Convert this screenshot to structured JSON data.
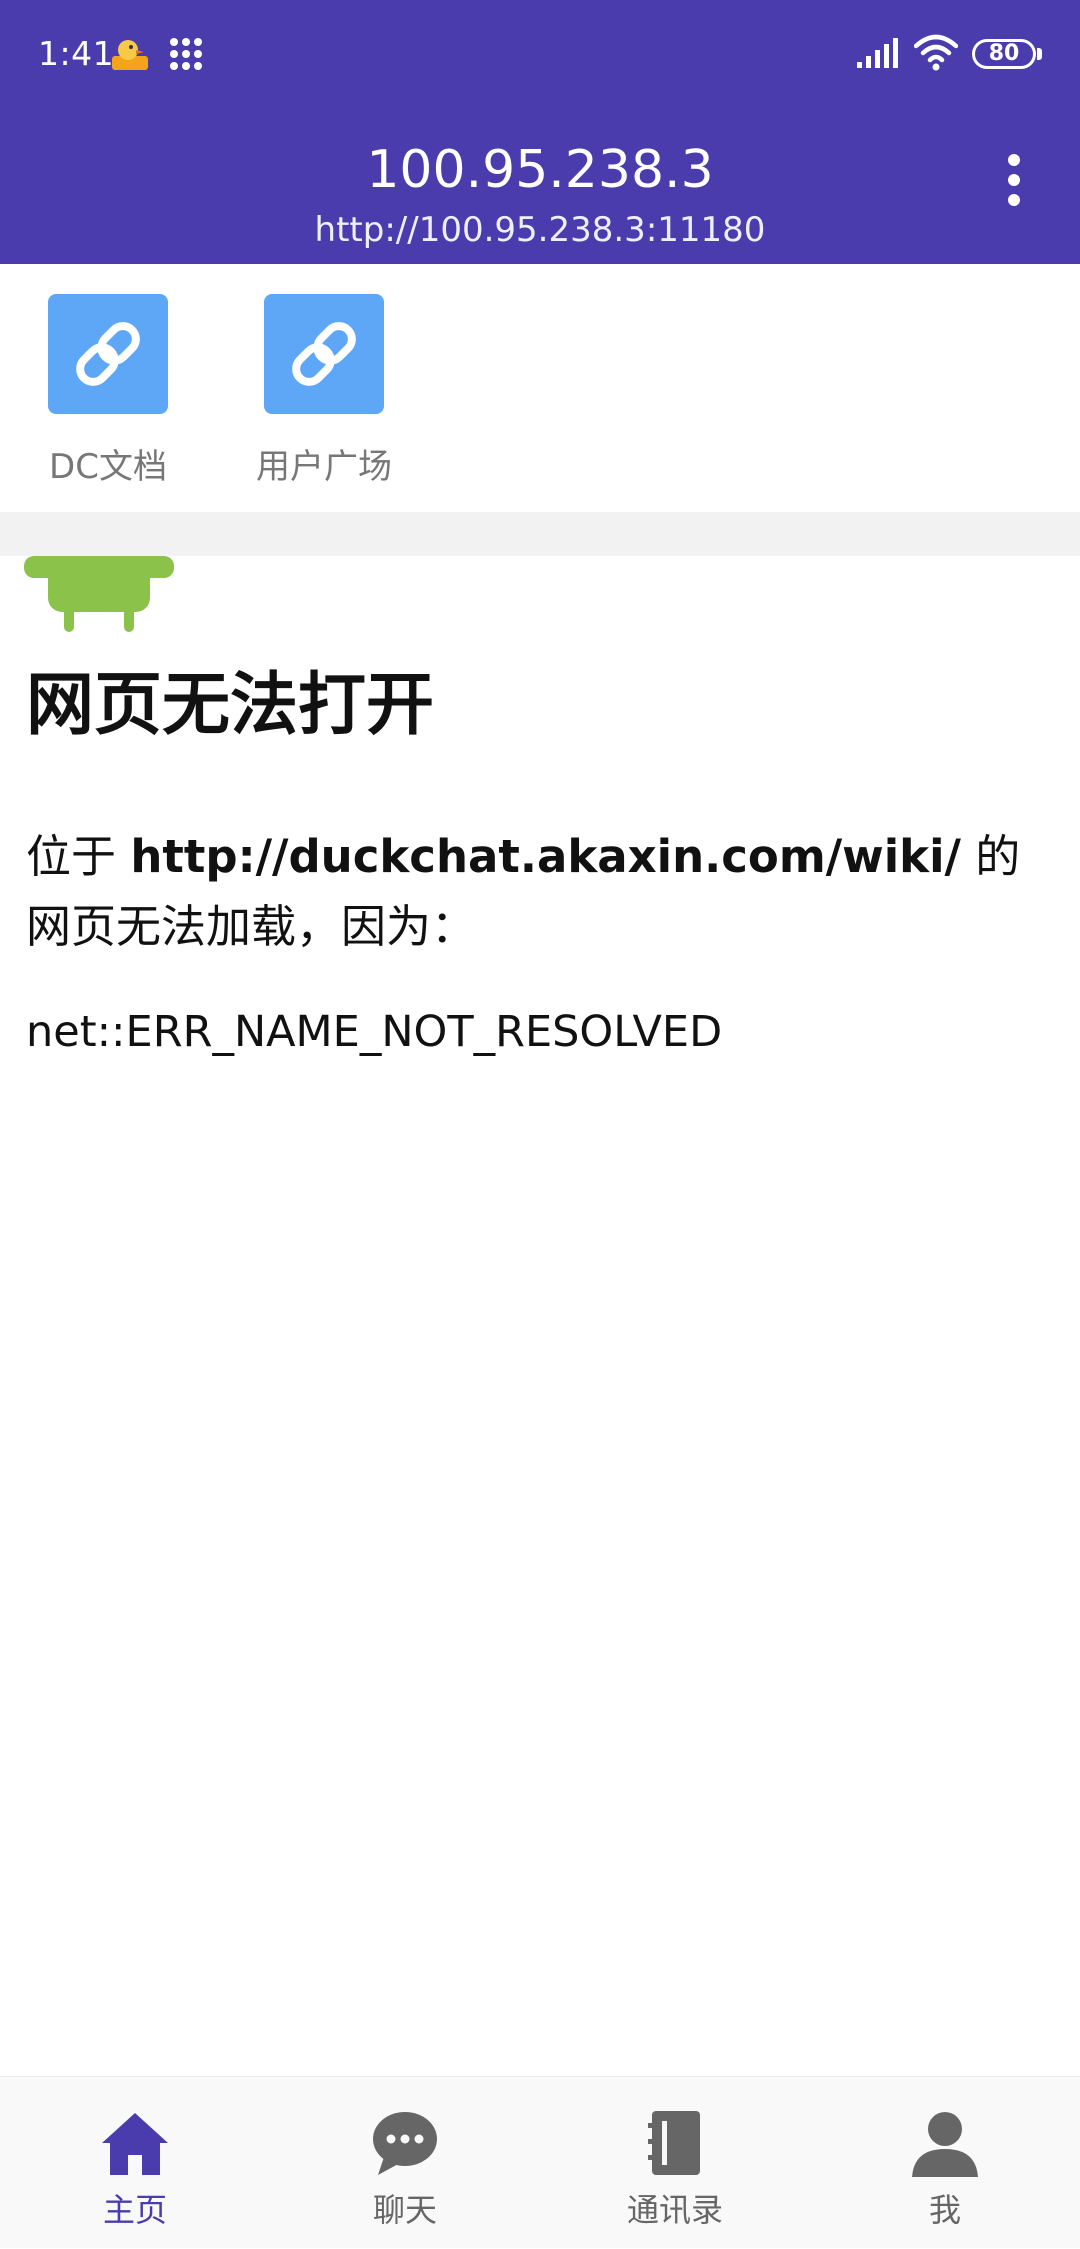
{
  "status_bar": {
    "time": "1:41",
    "battery": "80",
    "icons": [
      "duck-app-icon",
      "grid-icon",
      "signal-icon",
      "wifi-icon",
      "battery-icon"
    ]
  },
  "app_bar": {
    "title": "100.95.238.3",
    "subtitle": "http://100.95.238.3:11180",
    "menu_icon": "more-vertical-icon"
  },
  "shortcuts": [
    {
      "label": "DC文档",
      "icon": "link-icon"
    },
    {
      "label": "用户广场",
      "icon": "link-icon"
    }
  ],
  "error_page": {
    "heading": "网页无法打开",
    "desc_prefix": "位于 ",
    "url": "http://duckchat.akaxin.com/wiki/",
    "desc_suffix": " 的网页无法加载，因为：",
    "error_code": "net::ERR_NAME_NOT_RESOLVED",
    "icon": "android-icon"
  },
  "bottom_nav": {
    "items": [
      {
        "label": "主页",
        "icon": "home-icon",
        "active": true
      },
      {
        "label": "聊天",
        "icon": "chat-icon",
        "active": false
      },
      {
        "label": "通讯录",
        "icon": "contacts-book-icon",
        "active": false
      },
      {
        "label": "我",
        "icon": "person-icon",
        "active": false
      }
    ]
  },
  "colors": {
    "primary": "#4a3cad",
    "tile": "#5ea7f7",
    "android_green": "#8bc34a",
    "nav_inactive": "#666666"
  }
}
